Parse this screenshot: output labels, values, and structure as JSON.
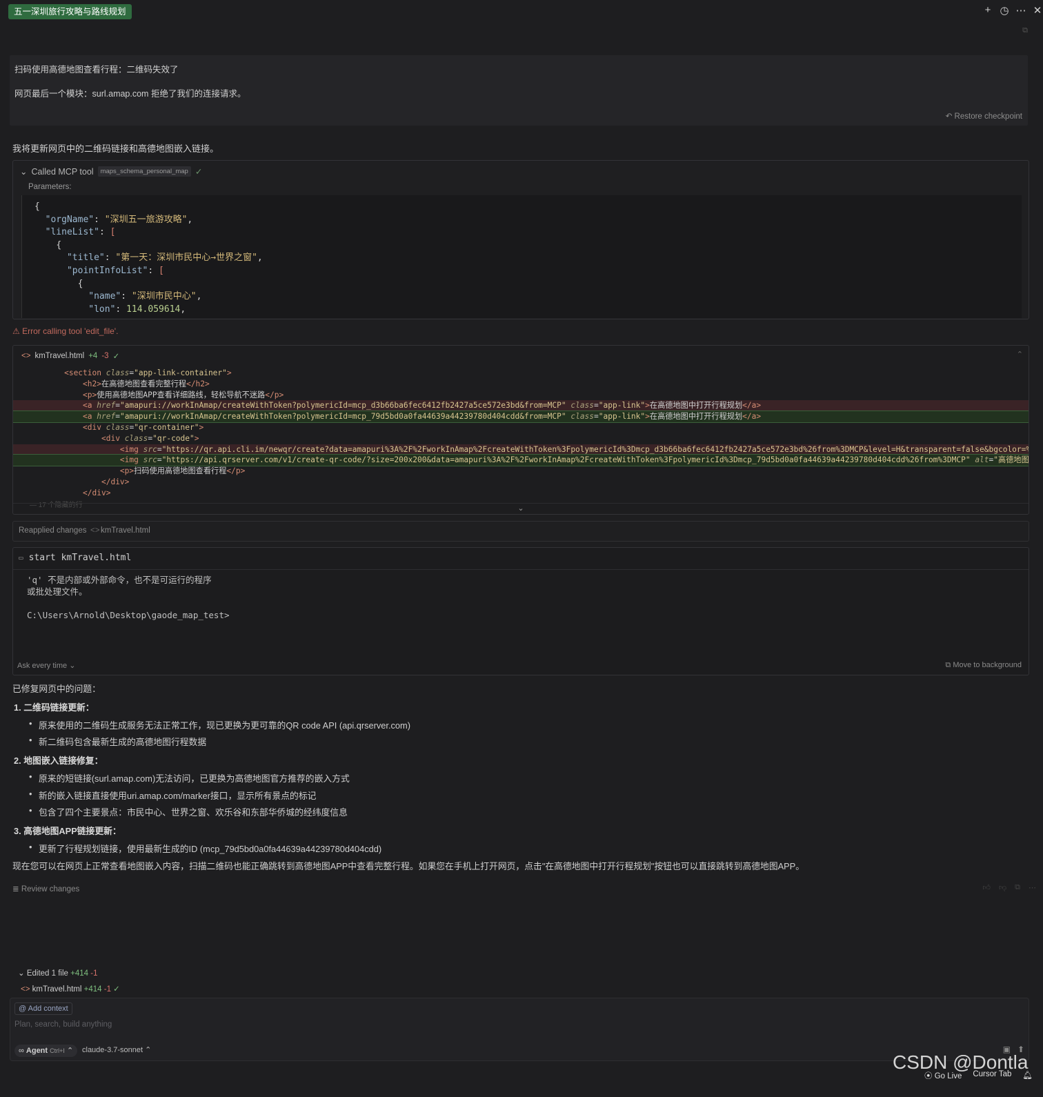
{
  "header": {
    "title": "五一深圳旅行攻略与路线规划",
    "icons": [
      "plus-icon",
      "history-icon",
      "more-icon",
      "close-icon"
    ]
  },
  "user_message": {
    "line1": "扫码使用高德地图查看行程：二维码失效了",
    "line2": "网页最后一个模块：surl.amap.com 拒绝了我们的连接请求。",
    "restore_label": "Restore checkpoint"
  },
  "assistant_intro": "我将更新网页中的二维码链接和高德地图嵌入链接。",
  "mcp_tool": {
    "label": "Called MCP tool",
    "tool_name": "maps_schema_personal_map",
    "params_label": "Parameters:",
    "json_lines": {
      "l1": "{",
      "l2_key": "\"orgName\"",
      "l2_val": "\"深圳五一旅游攻略\"",
      "l3_key": "\"lineList\"",
      "l3_val": "[",
      "l4": "{",
      "l5_key": "\"title\"",
      "l5_val": "\"第一天：深圳市民中心→世界之窗\"",
      "l6_key": "\"pointInfoList\"",
      "l6_val": "[",
      "l7": "{",
      "l8_key": "\"name\"",
      "l8_val": "\"深圳市民中心\"",
      "l9_key": "\"lon\"",
      "l9_val": "114.059614"
    }
  },
  "error_text": "Error calling tool 'edit_file'.",
  "diff": {
    "filename": "kmTravel.html",
    "added": "+4",
    "removed": "-3",
    "collapsed_hint": "17 个隐藏的行",
    "lines": {
      "section_class": "\"app-link-container\"",
      "h2_text": "在高德地图查看完整行程",
      "p_text": "使用高德地图APP查看详细路线，轻松导航不迷路",
      "a_old_href": "\"amapuri://workInAmap/createWithToken?polymericId=mcp_d3b66ba6fec6412fb2427a5ce572e3bd&from=MCP\"",
      "a_new_href": "\"amapuri://workInAmap/createWithToken?polymericId=mcp_79d5bd0a0fa44639a44239780d404cdd&from=MCP\"",
      "a_class": "\"app-link\"",
      "a_text": "在高德地图中打开行程规划",
      "qr_container": "\"qr-container\"",
      "qr_code": "\"qr-code\"",
      "img_old_src": "\"https://qr.api.cli.im/newqr/create?data=amapuri%3A%2F%2FworkInAmap%2FcreateWithToken%3FpolymericId%3Dmcp_d3b66ba6fec6412fb2427a5ce572e3bd%26from%3DMCP&level=H&transparent=false&bgcolor=%23FFFFFF&",
      "img_new_src": "\"https://api.qrserver.com/v1/create-qr-code/?size=200x200&data=amapuri%3A%2F%2FworkInAmap%2FcreateWithToken%3FpolymericId%3Dmcp_79d5bd0a0fa44639a44239780d404cdd%26from%3DMCP\"",
      "img_alt": "\"高德地图行程码\"",
      "qr_p_text": "扫码使用高德地图查看行程"
    }
  },
  "reapplied": {
    "label": "Reapplied changes",
    "file": "kmTravel.html"
  },
  "terminal": {
    "command": "start kmTravel.html",
    "output_line1": "'q' 不是内部或外部命令，也不是可运行的程序",
    "output_line2": "或批处理文件。",
    "output_line3": "C:\\Users\\Arnold\\Desktop\\gaode_map_test>",
    "ask_label": "Ask every time",
    "move_bg_label": "Move to background"
  },
  "summary": {
    "intro": "已修复网页中的问题：",
    "s1_title": "1. 二维码链接更新：",
    "s1_b1": "原来使用的二维码生成服务无法正常工作，现已更换为更可靠的QR code API (api.qrserver.com)",
    "s1_b2": "新二维码包含最新生成的高德地图行程数据",
    "s2_title": "2. 地图嵌入链接修复：",
    "s2_b1": "原来的短链接(surl.amap.com)无法访问，已更换为高德地图官方推荐的嵌入方式",
    "s2_b2": "新的嵌入链接直接使用uri.amap.com/marker接口，显示所有景点的标记",
    "s2_b3": "包含了四个主要景点：市民中心、世界之窗、欢乐谷和东部华侨城的经纬度信息",
    "s3_title": "3. 高德地图APP链接更新：",
    "s3_b1": "更新了行程规划链接，使用最新生成的ID (mcp_79d5bd0a0fa44639a44239780d404cdd)",
    "outro": "现在您可以在网页上正常查看地图嵌入内容，扫描二维码也能正确跳转到高德地图APP中查看完整行程。如果您在手机上打开网页，点击\"在高德地图中打开行程规划\"按钮也可以直接跳转到高德地图APP。"
  },
  "review_label": "Review changes",
  "edited": {
    "label": "Edited 1 file",
    "added": "+414",
    "removed": "-1",
    "file": "kmTravel.html",
    "file_added": "+414",
    "file_removed": "-1"
  },
  "composer": {
    "add_context": "Add context",
    "placeholder": "Plan, search, build anything",
    "agent_label": "Agent",
    "agent_shortcut": "Ctrl+I",
    "model": "claude-3.7-sonnet"
  },
  "status": {
    "watermark": "CSDN @Dontla",
    "go_live": "Go Live",
    "cursor_tab": "Cursor Tab"
  },
  "colors": {
    "background": "#1e1e20",
    "title_badge": "#2f6b3f",
    "diff_removed": "#3a2326",
    "diff_added": "#22321f",
    "error": "#c26a5e"
  }
}
